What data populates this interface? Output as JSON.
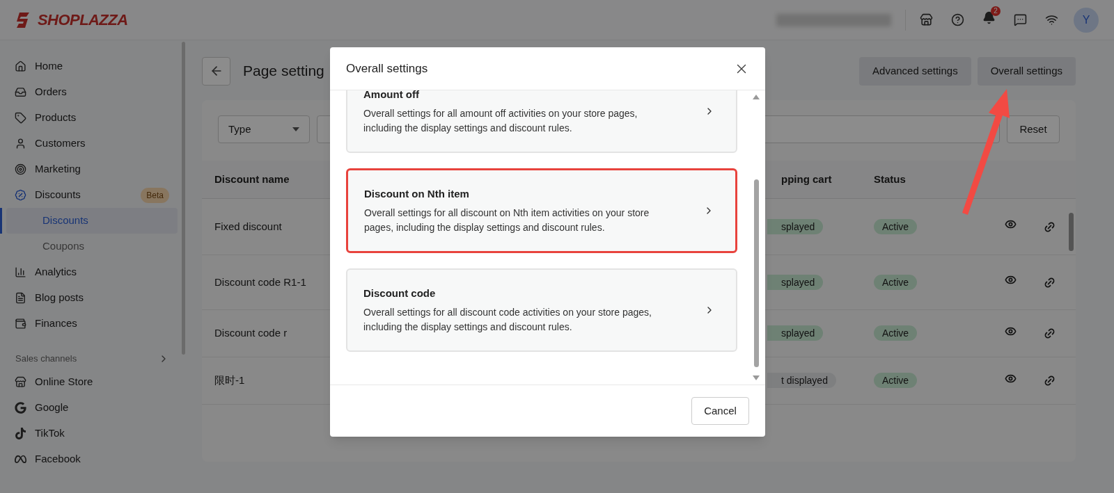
{
  "header": {
    "logo": "SHOPLAZZA",
    "notification_count": "2",
    "avatar": "Y"
  },
  "sidebar": {
    "items": [
      {
        "label": "Home",
        "selected": false
      },
      {
        "label": "Orders",
        "selected": false
      },
      {
        "label": "Products",
        "selected": false
      },
      {
        "label": "Customers",
        "selected": false
      },
      {
        "label": "Marketing",
        "selected": false
      },
      {
        "label": "Discounts",
        "selected": false,
        "badge": "Beta",
        "children": [
          {
            "label": "Discounts",
            "selected": true
          },
          {
            "label": "Coupons",
            "selected": false
          }
        ]
      },
      {
        "label": "Analytics",
        "selected": false
      },
      {
        "label": "Blog posts",
        "selected": false
      },
      {
        "label": "Finances",
        "selected": false
      }
    ],
    "section_title": "Sales channels",
    "channels": [
      {
        "label": "Online Store"
      },
      {
        "label": "Google"
      },
      {
        "label": "TikTok"
      },
      {
        "label": "Facebook"
      }
    ]
  },
  "page": {
    "title": "Page setting",
    "buttons": [
      "Advanced settings",
      "Overall settings"
    ]
  },
  "filters": {
    "type_select": "Type",
    "reset": "Reset"
  },
  "table": {
    "columns": [
      "Discount name",
      "pping cart",
      "Status"
    ],
    "rows": [
      {
        "name": "Fixed discount",
        "cart": "splayed",
        "displayed": true,
        "status": "Active"
      },
      {
        "name": "Discount code R1-1",
        "cart": "splayed",
        "displayed": true,
        "status": "Active"
      },
      {
        "name": "Discount code r",
        "cart": "splayed",
        "displayed": true,
        "status": "Active"
      },
      {
        "name": "限时-1",
        "cart": "t displayed",
        "displayed": false,
        "status": "Active"
      }
    ]
  },
  "modal": {
    "title": "Overall settings",
    "options": [
      {
        "title": "Amount off",
        "description": "Overall settings for all amount off activities on your store pages, including the display settings and discount rules.",
        "selected": false
      },
      {
        "title": "Discount on Nth item",
        "description": "Overall settings for all discount on Nth item activities on your store pages, including the display settings and discount rules.",
        "selected": true
      },
      {
        "title": "Discount code",
        "description": "Overall settings for all discount code activities on your store pages, including the display settings and discount rules.",
        "selected": false
      }
    ],
    "cancel": "Cancel"
  }
}
